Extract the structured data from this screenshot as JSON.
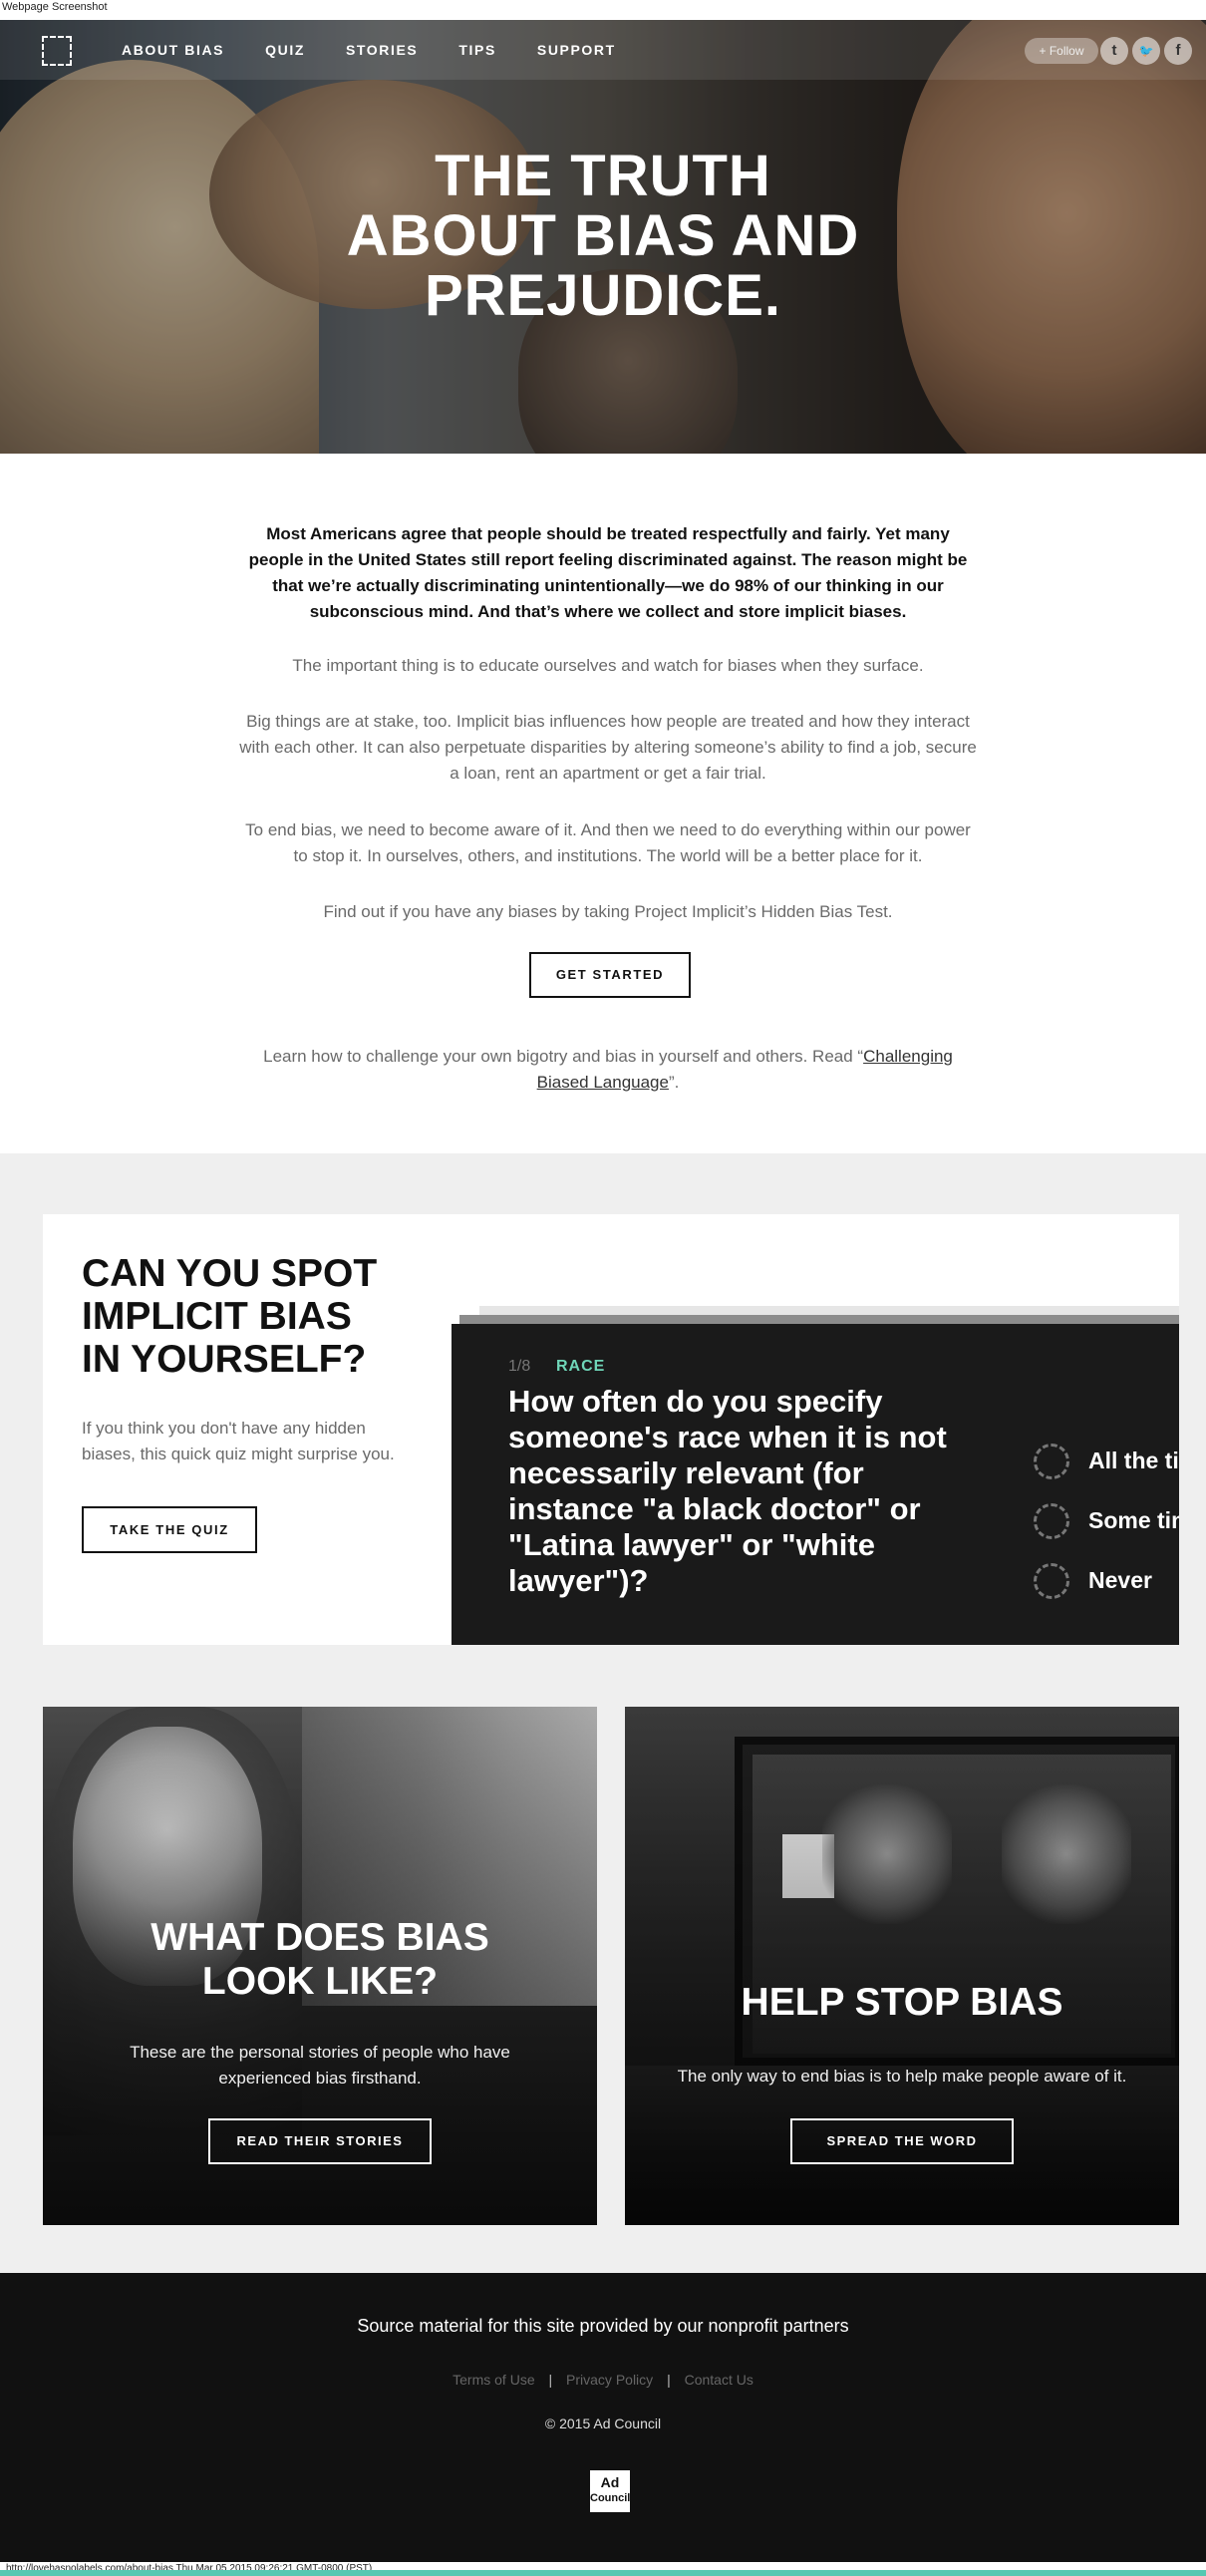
{
  "browser": {
    "header_label": "Webpage Screenshot",
    "status_url": "http://lovehasnolabels.com/about-bias Thu Mar 05 2015 09:26:21 GMT-0800 (PST)"
  },
  "nav": {
    "items": [
      {
        "label": "ABOUT BIAS"
      },
      {
        "label": "QUIZ"
      },
      {
        "label": "STORIES"
      },
      {
        "label": "TIPS"
      },
      {
        "label": "SUPPORT"
      }
    ],
    "follow_label": "+ Follow",
    "social": [
      {
        "icon": "tumblr-icon",
        "glyph": "t"
      },
      {
        "icon": "twitter-icon",
        "glyph": "🐦"
      },
      {
        "icon": "facebook-icon",
        "glyph": "f"
      }
    ]
  },
  "hero": {
    "title_lines": [
      "THE TRUTH",
      "ABOUT BIAS AND",
      "PREJUDICE."
    ]
  },
  "intro": {
    "lead": "Most Americans agree that people should be treated respectfully and fairly. Yet many people in the United States still report feeling discriminated against. The reason might be that we’re actually discriminating unintentionally—we do 98% of our thinking in our subconscious mind. And that’s where we collect and store implicit biases.",
    "p1": "The important thing is to educate ourselves and watch for biases when they surface.",
    "p2": "Big things are at stake, too. Implicit bias influences how people are treated and how they interact with each other. It can also perpetuate disparities by altering someone’s ability to find a job, secure a loan, rent an apartment or get a fair trial.",
    "p3": "To end bias, we need to become aware of it. And then we need to do everything within our power to stop it. In ourselves, others, and institutions. The world will be a better place for it.",
    "p4": "Find out if you have any biases by taking Project Implicit’s Hidden Bias Test.",
    "cta_label": "GET STARTED",
    "challenge_prefix": "Learn how to challenge your own bigotry and bias in yourself and others. Read “",
    "challenge_link": "Challenging Biased Language",
    "challenge_suffix": "”."
  },
  "quiz": {
    "heading_lines": [
      "CAN YOU SPOT",
      "IMPLICIT BIAS",
      "IN YOURSELF?"
    ],
    "subtext": "If you think you don't have any hidden biases, this quick quiz might surprise you.",
    "button_label": "TAKE THE QUIZ",
    "progress": "1/8",
    "category": "RACE",
    "question": "How often do you specify someone's race when it is not necessarily relevant (for instance \"a black doctor\" or \"Latina lawyer\" or \"white lawyer\")?",
    "options": [
      "All the time",
      "Some times",
      "Never"
    ],
    "accent_color": "#6fd6b8"
  },
  "cards": {
    "stories": {
      "title_lines": [
        "WHAT DOES BIAS",
        "LOOK LIKE?"
      ],
      "text": "These are the personal stories of people who have experienced bias firsthand.",
      "button_label": "READ THEIR STORIES"
    },
    "spread": {
      "title": "HELP STOP BIAS",
      "text": "The only way to end bias is to help make people aware of it.",
      "button_label": "SPREAD THE WORD"
    }
  },
  "footer": {
    "source_text": "Source material for this site provided by our nonprofit partners",
    "links": [
      "Terms of Use",
      "Privacy Policy",
      "Contact Us"
    ],
    "copyright": "© 2015 Ad Council",
    "logo_text": [
      "Ad",
      "Council"
    ]
  }
}
